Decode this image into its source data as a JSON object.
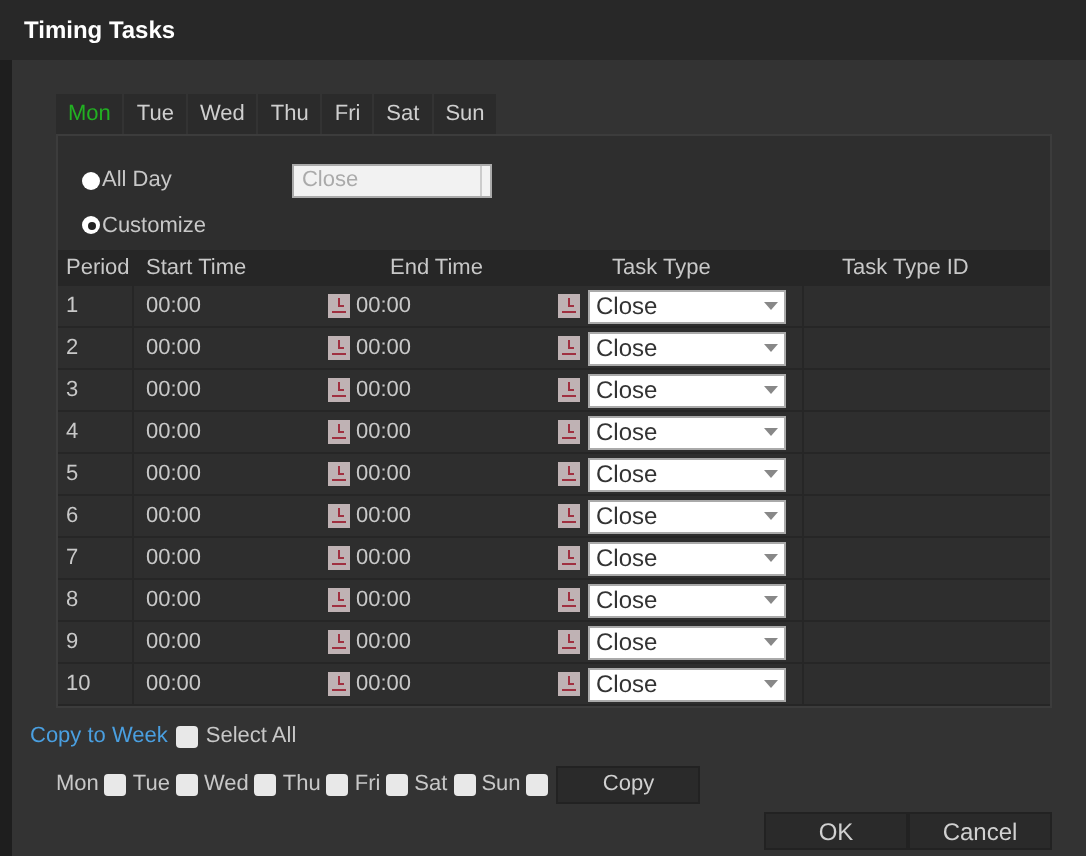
{
  "window": {
    "title": "Timing Tasks"
  },
  "tabs": [
    {
      "label": "Mon",
      "selected": true
    },
    {
      "label": "Tue",
      "selected": false
    },
    {
      "label": "Wed",
      "selected": false
    },
    {
      "label": "Thu",
      "selected": false
    },
    {
      "label": "Fri",
      "selected": false
    },
    {
      "label": "Sat",
      "selected": false
    },
    {
      "label": "Sun",
      "selected": false
    }
  ],
  "mode_options": [
    {
      "label": "All Day",
      "selected": false
    },
    {
      "label": "Customize",
      "selected": true
    }
  ],
  "all_day_select": {
    "value": "Close",
    "disabled": true
  },
  "table": {
    "columns": [
      "Period",
      "Start Time",
      "End Time",
      "Task Type",
      "Task Type ID"
    ],
    "rows": [
      {
        "period": "1",
        "start": "00:00",
        "end": "00:00",
        "task_type": "Close"
      },
      {
        "period": "2",
        "start": "00:00",
        "end": "00:00",
        "task_type": "Close"
      },
      {
        "period": "3",
        "start": "00:00",
        "end": "00:00",
        "task_type": "Close"
      },
      {
        "period": "4",
        "start": "00:00",
        "end": "00:00",
        "task_type": "Close"
      },
      {
        "period": "5",
        "start": "00:00",
        "end": "00:00",
        "task_type": "Close"
      },
      {
        "period": "6",
        "start": "00:00",
        "end": "00:00",
        "task_type": "Close"
      },
      {
        "period": "7",
        "start": "00:00",
        "end": "00:00",
        "task_type": "Close"
      },
      {
        "period": "8",
        "start": "00:00",
        "end": "00:00",
        "task_type": "Close"
      },
      {
        "period": "9",
        "start": "00:00",
        "end": "00:00",
        "task_type": "Close"
      },
      {
        "period": "10",
        "start": "00:00",
        "end": "00:00",
        "task_type": "Close"
      }
    ]
  },
  "copy_to_week": {
    "link": "Copy to Week",
    "select_all": {
      "label": "Select All",
      "checked": false
    },
    "days": [
      {
        "label": "Mon",
        "checked": false
      },
      {
        "label": "Tue",
        "checked": false
      },
      {
        "label": "Wed",
        "checked": false
      },
      {
        "label": "Thu",
        "checked": false
      },
      {
        "label": "Fri",
        "checked": false
      },
      {
        "label": "Sat",
        "checked": false
      },
      {
        "label": "Sun",
        "checked": false
      }
    ],
    "copy_button": "Copy"
  },
  "buttons": [
    "OK",
    "Cancel"
  ]
}
